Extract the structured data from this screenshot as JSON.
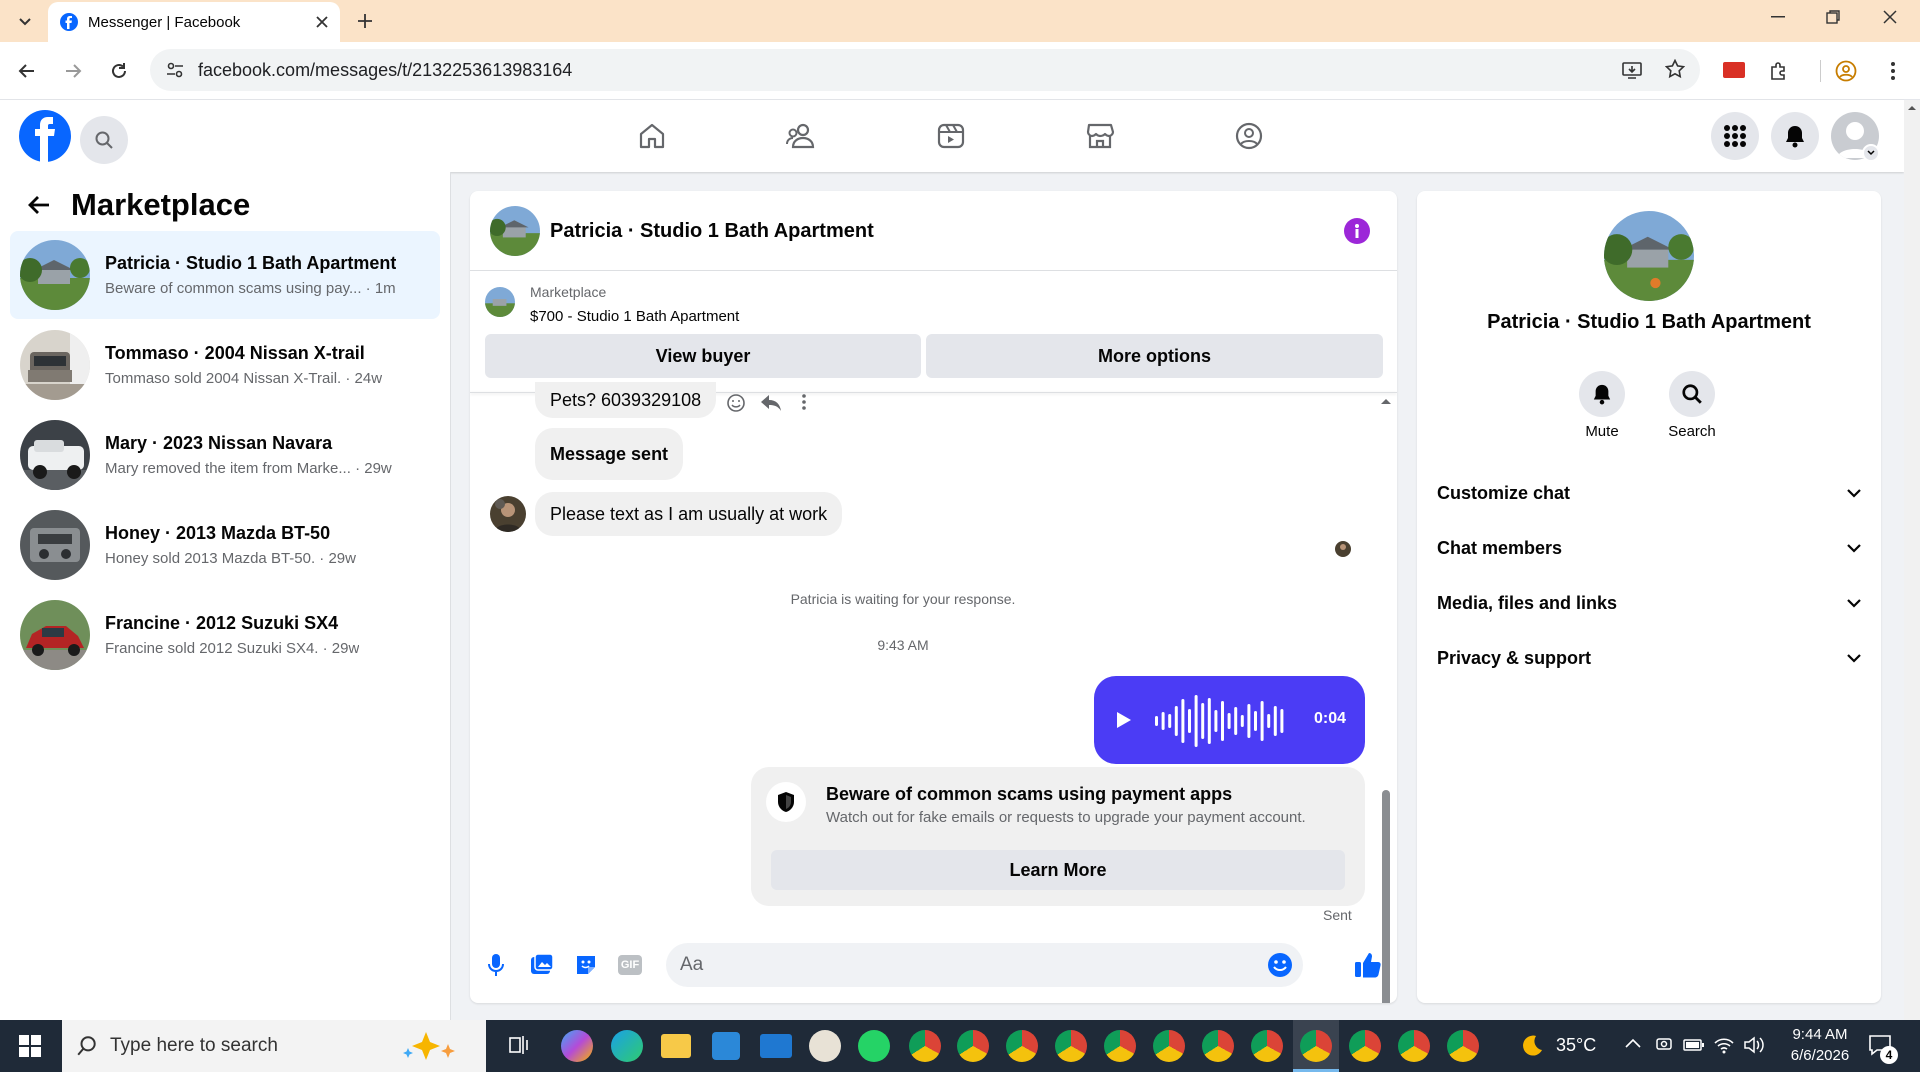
{
  "browser": {
    "tab_title": "Messenger | Facebook",
    "url": "facebook.com/messages/t/2132253613983164"
  },
  "sidebar": {
    "title": "Marketplace",
    "conversations": [
      {
        "name": "Patricia · Studio 1 Bath Apartment",
        "preview": "Beware of common scams using pay...",
        "time": "· 1m",
        "active": true
      },
      {
        "name": "Tommaso · 2004 Nissan X-trail",
        "preview": "Tommaso sold 2004 Nissan X-Trail.",
        "time": "· 24w"
      },
      {
        "name": "Mary · 2023 Nissan Navara",
        "preview": "Mary removed the item from Marke...",
        "time": "· 29w"
      },
      {
        "name": "Honey · 2013 Mazda BT-50",
        "preview": "Honey sold 2013 Mazda BT-50.",
        "time": "· 29w"
      },
      {
        "name": "Francine · 2012 Suzuki SX4",
        "preview": "Francine sold 2012 Suzuki SX4.",
        "time": "· 29w"
      }
    ]
  },
  "chat": {
    "title": "Patricia · Studio 1 Bath Apartment",
    "listing_source": "Marketplace",
    "listing_title": "$700 - Studio 1 Bath Apartment",
    "view_buyer": "View buyer",
    "more_options": "More options",
    "messages": [
      {
        "text": "Pets? 6039329108"
      },
      {
        "text": "Message sent"
      },
      {
        "text": "Please text as I am usually at work"
      }
    ],
    "waiting_notice": "Patricia is waiting for your response.",
    "timestamp": "9:43 AM",
    "voice_duration": "0:04",
    "warning_title": "Beware of common scams using payment apps",
    "warning_body": "Watch out for fake emails or requests to upgrade your payment account.",
    "learn_more": "Learn More",
    "sent_status": "Sent",
    "composer_placeholder": "Aa",
    "gif_label": "GIF",
    "accent_color": "#4b3cf5",
    "fb_blue": "#0866ff"
  },
  "details": {
    "name": "Patricia · Studio 1 Bath Apartment",
    "mute": "Mute",
    "search": "Search",
    "sections": [
      "Customize chat",
      "Chat members",
      "Media, files and links",
      "Privacy & support"
    ]
  },
  "taskbar": {
    "search_placeholder": "Type here to search",
    "temperature": "35°C",
    "time": "9:44 AM",
    "date": "6/6/2026",
    "notification_count": "4"
  }
}
